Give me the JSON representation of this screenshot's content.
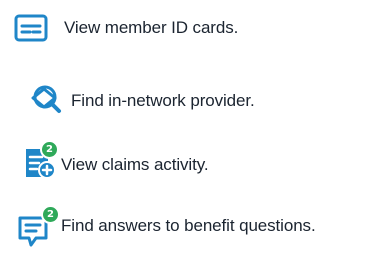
{
  "colors": {
    "icon_primary": "#1f86c8",
    "badge": "#2fa95a",
    "text": "#1b2430"
  },
  "items": [
    {
      "label": "View member ID cards.",
      "icon": "id-card-icon"
    },
    {
      "label": "Find in-network provider.",
      "icon": "provider-search-icon"
    },
    {
      "label": "View claims activity.",
      "icon": "claims-document-icon",
      "badge": "2"
    },
    {
      "label": "Find answers to benefit questions.",
      "icon": "chat-bubble-icon",
      "badge": "2"
    }
  ]
}
